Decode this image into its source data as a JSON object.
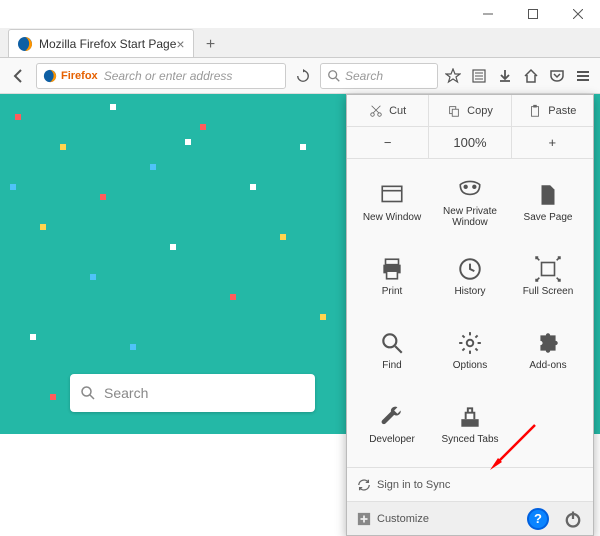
{
  "window": {
    "tab_title": "Mozilla Firefox Start Page"
  },
  "navbar": {
    "firefox_label": "Firefox",
    "url_placeholder": "Search or enter address",
    "search_placeholder": "Search"
  },
  "home": {
    "search_placeholder": "Search"
  },
  "menu": {
    "cut": "Cut",
    "copy": "Copy",
    "paste": "Paste",
    "zoom_minus": "−",
    "zoom_value": "100%",
    "zoom_plus": "+",
    "items": [
      {
        "label": "New Window"
      },
      {
        "label": "New Private\nWindow"
      },
      {
        "label": "Save Page"
      },
      {
        "label": "Print"
      },
      {
        "label": "History"
      },
      {
        "label": "Full Screen"
      },
      {
        "label": "Find"
      },
      {
        "label": "Options"
      },
      {
        "label": "Add-ons"
      },
      {
        "label": "Developer"
      },
      {
        "label": "Synced Tabs"
      }
    ],
    "signin": "Sign in to Sync",
    "customize": "Customize",
    "help": "?"
  },
  "colors": {
    "accent_bg": "#24b8a6",
    "highlight_border": "#d33",
    "help_blue": "#0a84ff"
  }
}
